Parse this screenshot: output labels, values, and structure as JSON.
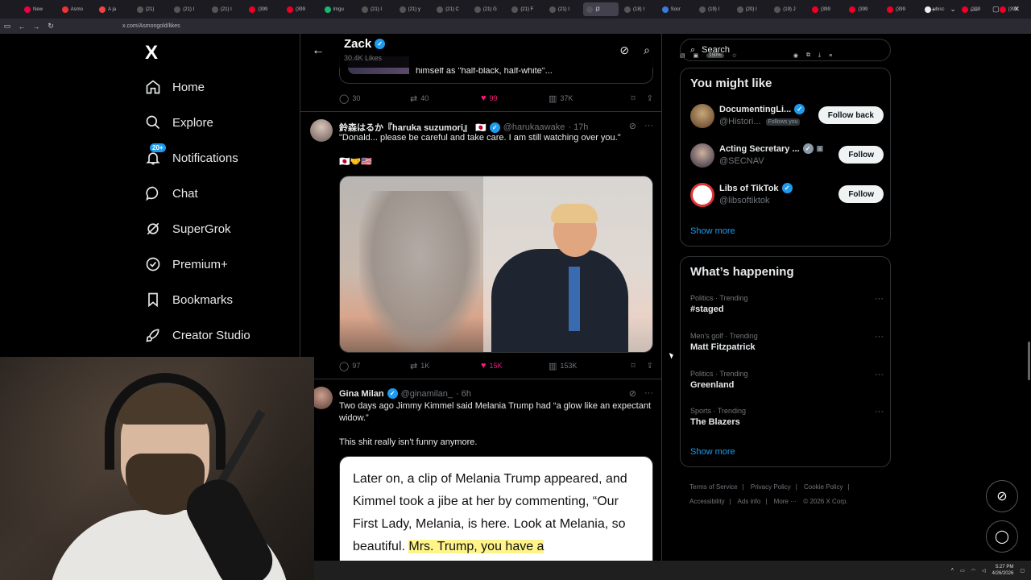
{
  "browser": {
    "tabs": [
      {
        "label": "New",
        "color": "#e04"
      },
      {
        "label": "Asmo",
        "color": "#e33"
      },
      {
        "label": "A ja",
        "color": "#e44"
      },
      {
        "label": "(21)",
        "color": "#555"
      },
      {
        "label": "(21) I",
        "color": "#555"
      },
      {
        "label": "(21) I",
        "color": "#555"
      },
      {
        "label": "(399",
        "color": "#e02"
      },
      {
        "label": "(399",
        "color": "#e02"
      },
      {
        "label": "Imgu",
        "color": "#1bb76e"
      },
      {
        "label": "(21) I",
        "color": "#555"
      },
      {
        "label": "(21) y",
        "color": "#555"
      },
      {
        "label": "(21) C",
        "color": "#555"
      },
      {
        "label": "(21) G",
        "color": "#555"
      },
      {
        "label": "(21) F",
        "color": "#555"
      },
      {
        "label": "(21) I",
        "color": "#555"
      },
      {
        "label": "(2",
        "color": "#555",
        "active": true
      },
      {
        "label": "(18) I",
        "color": "#555"
      },
      {
        "label": "Socr",
        "color": "#3a7bd5"
      },
      {
        "label": "(19) I",
        "color": "#555"
      },
      {
        "label": "(20) I",
        "color": "#555"
      },
      {
        "label": "(19) J",
        "color": "#555"
      },
      {
        "label": "(399",
        "color": "#e02"
      },
      {
        "label": "(399",
        "color": "#e02"
      },
      {
        "label": "(399",
        "color": "#e02"
      },
      {
        "label": "ubisc",
        "color": "#eee"
      },
      {
        "label": "(399",
        "color": "#e02"
      },
      {
        "label": "(399",
        "color": "#e02"
      }
    ],
    "url": "x.com/Asmongold/likes",
    "zoom": "150%"
  },
  "nav": {
    "logo": "X",
    "items": [
      {
        "label": "Home",
        "icon": "home-icon"
      },
      {
        "label": "Explore",
        "icon": "search-icon"
      },
      {
        "label": "Notifications",
        "icon": "bell-icon",
        "badge": "20+"
      },
      {
        "label": "Chat",
        "icon": "chat-icon"
      },
      {
        "label": "SuperGrok",
        "icon": "grok-icon"
      },
      {
        "label": "Premium+",
        "icon": "verified-icon"
      },
      {
        "label": "Bookmarks",
        "icon": "bookmark-icon"
      },
      {
        "label": "Creator Studio",
        "icon": "rocket-icon"
      }
    ]
  },
  "header": {
    "name": "Zack",
    "sub": "30.4K Likes"
  },
  "fragment": {
    "text": "himself as \"half-black, half-white\"..."
  },
  "tweet0_actions": {
    "reply": "30",
    "rt": "40",
    "like": "99",
    "views": "37K"
  },
  "tweet1": {
    "name": "鈴森はるか『haruka suzumori』",
    "handle": "@harukaawake",
    "time": "· 17h",
    "text": "\"Donald... please be careful and take care. I am still watching over you.\"",
    "emoji": "🇯🇵🤝🇺🇸",
    "actions": {
      "reply": "97",
      "rt": "1K",
      "like": "15K",
      "views": "153K"
    }
  },
  "tweet2": {
    "name": "Gina Milan",
    "handle": "@ginamilan_",
    "time": "· 6h",
    "text1": "Two days ago Jimmy Kimmel said Melania Trump had “a glow like an expectant widow.”",
    "text2": "This shit really isn't funny anymore.",
    "quote_plain": "Later on, a clip of Melania Trump appeared, and Kimmel took a jibe at her by commenting, “Our First Lady, Melania, is here. Look at Melania, so beautiful. ",
    "quote_highlight": "Mrs. Trump, you have a"
  },
  "right": {
    "search_placeholder": "Search",
    "wtf_title": "You might like",
    "wtf": [
      {
        "name": "DocumentingLi...",
        "handle": "@Histori...",
        "follows_you": "Follows you",
        "button": "Follow back",
        "color": "#7a5a3a"
      },
      {
        "name": "Acting Secretary ...",
        "handle": "@SECNAV",
        "button": "Follow",
        "color": "#555"
      },
      {
        "name": "Libs of TikTok",
        "handle": "@libsoftiktok",
        "button": "Follow",
        "color": "#c33"
      }
    ],
    "show_more": "Show more",
    "trends_title": "What’s happening",
    "trends": [
      {
        "category": "Politics · Trending",
        "name": "#staged"
      },
      {
        "category": "Men's golf · Trending",
        "name": "Matt Fitzpatrick"
      },
      {
        "category": "Politics · Trending",
        "name": "Greenland"
      },
      {
        "category": "Sports · Trending",
        "name": "The Blazers"
      }
    ],
    "footer": [
      "Terms of Service",
      "|",
      "Privacy Policy",
      "|",
      "Cookie Policy",
      "|",
      "Accessibility",
      "|",
      "Ads info",
      "|",
      "More ···",
      "© 2026 X Corp."
    ]
  },
  "taskbar": {
    "time": "5:27 PM",
    "date": "4/26/2026"
  }
}
